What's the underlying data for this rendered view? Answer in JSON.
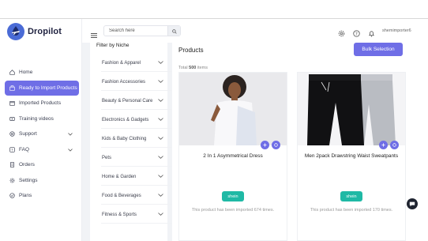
{
  "app": {
    "name": "Dropilot",
    "brand_color": "#6f6ee6",
    "accent_teal": "#1fb9a5"
  },
  "sidebar": {
    "items": [
      {
        "label": "Home",
        "icon": "home-icon"
      },
      {
        "label": "Ready to Import Products",
        "icon": "import-icon",
        "active": true
      },
      {
        "label": "Imported Products",
        "icon": "box-icon"
      },
      {
        "label": "Training videos",
        "icon": "video-icon"
      },
      {
        "label": "Support",
        "icon": "support-icon",
        "expandable": true
      },
      {
        "label": "FAQ",
        "icon": "faq-icon",
        "expandable": true
      },
      {
        "label": "Orders",
        "icon": "orders-icon"
      },
      {
        "label": "Settings",
        "icon": "gear-icon"
      },
      {
        "label": "Plans",
        "icon": "plans-icon"
      }
    ]
  },
  "header": {
    "search_placeholder": "Search here",
    "username": "shemimporter6"
  },
  "filter": {
    "title": "Filter by Niche",
    "niches": [
      "Fashion & Apparel",
      "Fashion Accessories",
      "Beauty & Personal Care",
      "Electronics & Gadgets",
      "Kids & Baby Clothing",
      "Pets",
      "Home & Garden",
      "Food & Beverages",
      "Fitness & Sports"
    ]
  },
  "products": {
    "title": "Products",
    "bulk_label": "Bulk Selection",
    "total_prefix": "Total",
    "total_count": "500",
    "total_suffix": "items",
    "items": [
      {
        "name": "2 In 1 Asymmetrical Dress",
        "store": "shein",
        "imported": "This product has been imported 674 times."
      },
      {
        "name": "Men 2pack Drawstring Waist Sweatpants",
        "store": "shein",
        "imported": "This product has been imported 170 times."
      }
    ]
  }
}
